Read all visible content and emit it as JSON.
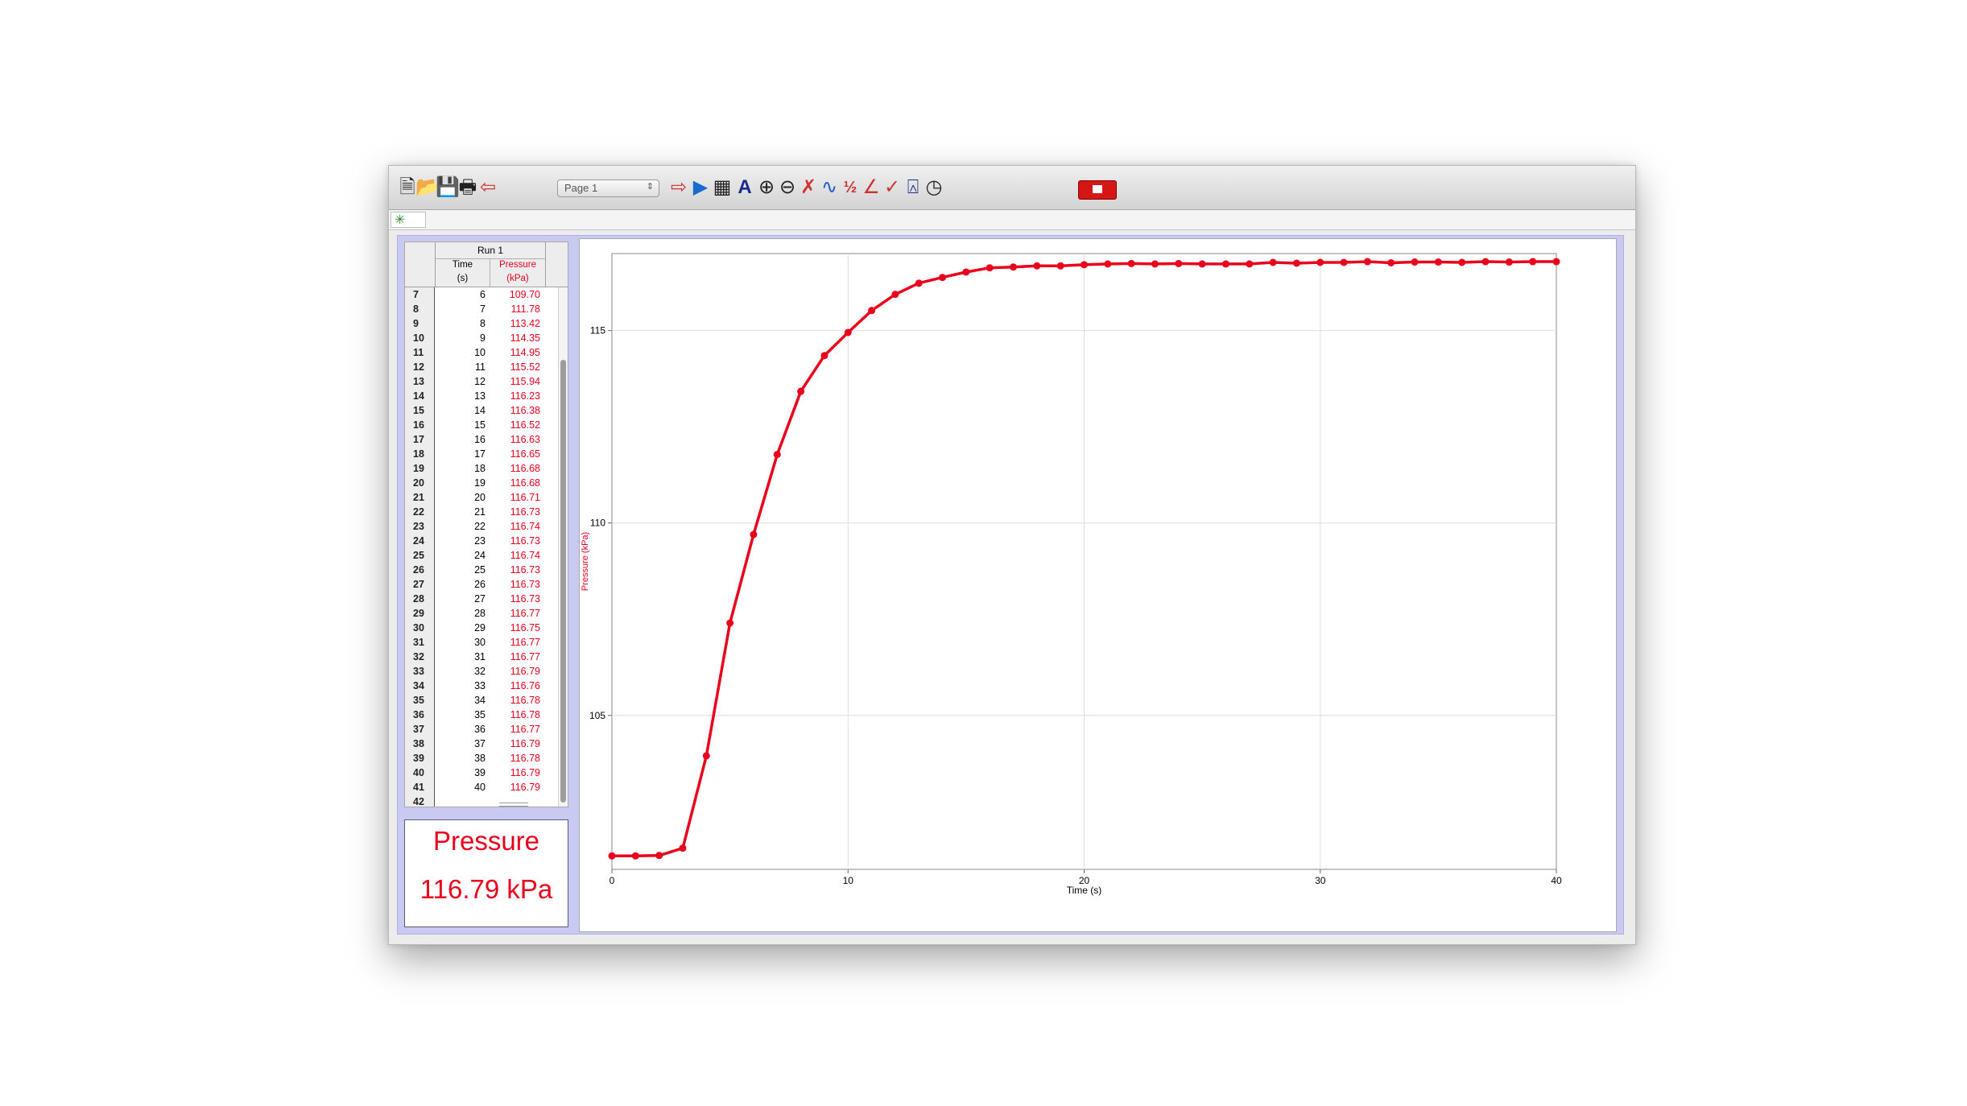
{
  "toolbar": {
    "icons": [
      "new-file-icon",
      "open-folder-icon",
      "save-icon",
      "print-icon",
      "import-icon",
      "export-icon",
      "data-browser-icon",
      "calculator-icon",
      "autoscale-icon",
      "zoom-in-icon",
      "zoom-out-icon",
      "examine-icon",
      "tangent-icon",
      "integral-icon",
      "statistics-icon",
      "curve-fit-icon",
      "model-icon",
      "timing-icon",
      "stop-icon"
    ],
    "page_select": "Page 1"
  },
  "table": {
    "run_label": "Run 1",
    "col_time": [
      "Time",
      "(s)"
    ],
    "col_pressure": [
      "Pressure",
      "(kPa)"
    ],
    "rows": [
      {
        "i": "7",
        "t": "6",
        "p": "109.70"
      },
      {
        "i": "8",
        "t": "7",
        "p": "111.78"
      },
      {
        "i": "9",
        "t": "8",
        "p": "113.42"
      },
      {
        "i": "10",
        "t": "9",
        "p": "114.35"
      },
      {
        "i": "11",
        "t": "10",
        "p": "114.95"
      },
      {
        "i": "12",
        "t": "11",
        "p": "115.52"
      },
      {
        "i": "13",
        "t": "12",
        "p": "115.94"
      },
      {
        "i": "14",
        "t": "13",
        "p": "116.23"
      },
      {
        "i": "15",
        "t": "14",
        "p": "116.38"
      },
      {
        "i": "16",
        "t": "15",
        "p": "116.52"
      },
      {
        "i": "17",
        "t": "16",
        "p": "116.63"
      },
      {
        "i": "18",
        "t": "17",
        "p": "116.65"
      },
      {
        "i": "19",
        "t": "18",
        "p": "116.68"
      },
      {
        "i": "20",
        "t": "19",
        "p": "116.68"
      },
      {
        "i": "21",
        "t": "20",
        "p": "116.71"
      },
      {
        "i": "22",
        "t": "21",
        "p": "116.73"
      },
      {
        "i": "23",
        "t": "22",
        "p": "116.74"
      },
      {
        "i": "24",
        "t": "23",
        "p": "116.73"
      },
      {
        "i": "25",
        "t": "24",
        "p": "116.74"
      },
      {
        "i": "26",
        "t": "25",
        "p": "116.73"
      },
      {
        "i": "27",
        "t": "26",
        "p": "116.73"
      },
      {
        "i": "28",
        "t": "27",
        "p": "116.73"
      },
      {
        "i": "29",
        "t": "28",
        "p": "116.77"
      },
      {
        "i": "30",
        "t": "29",
        "p": "116.75"
      },
      {
        "i": "31",
        "t": "30",
        "p": "116.77"
      },
      {
        "i": "32",
        "t": "31",
        "p": "116.77"
      },
      {
        "i": "33",
        "t": "32",
        "p": "116.79"
      },
      {
        "i": "34",
        "t": "33",
        "p": "116.76"
      },
      {
        "i": "35",
        "t": "34",
        "p": "116.78"
      },
      {
        "i": "36",
        "t": "35",
        "p": "116.78"
      },
      {
        "i": "37",
        "t": "36",
        "p": "116.77"
      },
      {
        "i": "38",
        "t": "37",
        "p": "116.79"
      },
      {
        "i": "39",
        "t": "38",
        "p": "116.78"
      },
      {
        "i": "40",
        "t": "39",
        "p": "116.79"
      },
      {
        "i": "41",
        "t": "40",
        "p": "116.79"
      },
      {
        "i": "42",
        "t": "",
        "p": ""
      }
    ]
  },
  "meter": {
    "label": "Pressure",
    "value": "116.79 kPa"
  },
  "colors": {
    "series": "#e8001c",
    "panel_background": "#c9c9f2"
  },
  "chart_data": {
    "type": "line",
    "xlabel": "Time (s)",
    "ylabel": "Pressure (kPa)",
    "xlim": [
      0,
      40
    ],
    "ylim": [
      101,
      117
    ],
    "xticks": [
      0,
      10,
      20,
      30,
      40
    ],
    "yticks": [
      105,
      110,
      115
    ],
    "grid": true,
    "series": [
      {
        "x": [
          0,
          1,
          2,
          3,
          4,
          5,
          6,
          7,
          8,
          9,
          10,
          11,
          12,
          13,
          14,
          15,
          16,
          17,
          18,
          19,
          20,
          21,
          22,
          23,
          24,
          25,
          26,
          27,
          28,
          29,
          30,
          31,
          32,
          33,
          34,
          35,
          36,
          37,
          38,
          39,
          40
        ],
        "values": [
          101.35,
          101.35,
          101.36,
          101.55,
          103.95,
          107.4,
          109.7,
          111.78,
          113.42,
          114.35,
          114.95,
          115.52,
          115.94,
          116.23,
          116.38,
          116.52,
          116.63,
          116.65,
          116.68,
          116.68,
          116.71,
          116.73,
          116.74,
          116.73,
          116.74,
          116.73,
          116.73,
          116.73,
          116.77,
          116.75,
          116.77,
          116.77,
          116.79,
          116.76,
          116.78,
          116.78,
          116.77,
          116.79,
          116.78,
          116.79,
          116.79
        ]
      }
    ]
  }
}
